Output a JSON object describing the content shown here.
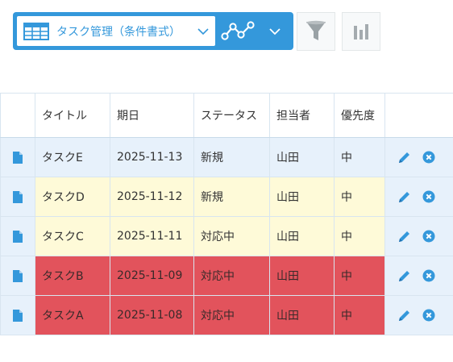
{
  "toolbar": {
    "view_label": "タスク管理（条件書式）",
    "view_icon": "table-view-icon",
    "graph_icon": "graph-icon",
    "filter_icon": "filter-icon",
    "chart_icon": "bar-chart-icon"
  },
  "colors": {
    "accent": "#3498db",
    "row_blue": "#e7f1fb",
    "row_yellow": "#fefad8",
    "row_red": "#e2535c"
  },
  "table": {
    "columns": [
      "タイトル",
      "期日",
      "ステータス",
      "担当者",
      "優先度"
    ],
    "rows": [
      {
        "title": "タスクE",
        "due": "2025-11-13",
        "status": "新規",
        "assignee": "山田",
        "priority": "中",
        "highlight": "blue"
      },
      {
        "title": "タスクD",
        "due": "2025-11-12",
        "status": "新規",
        "assignee": "山田",
        "priority": "中",
        "highlight": "yellow"
      },
      {
        "title": "タスクC",
        "due": "2025-11-11",
        "status": "対応中",
        "assignee": "山田",
        "priority": "中",
        "highlight": "yellow"
      },
      {
        "title": "タスクB",
        "due": "2025-11-09",
        "status": "対応中",
        "assignee": "山田",
        "priority": "中",
        "highlight": "red"
      },
      {
        "title": "タスクA",
        "due": "2025-11-08",
        "status": "対応中",
        "assignee": "山田",
        "priority": "中",
        "highlight": "red"
      }
    ]
  }
}
